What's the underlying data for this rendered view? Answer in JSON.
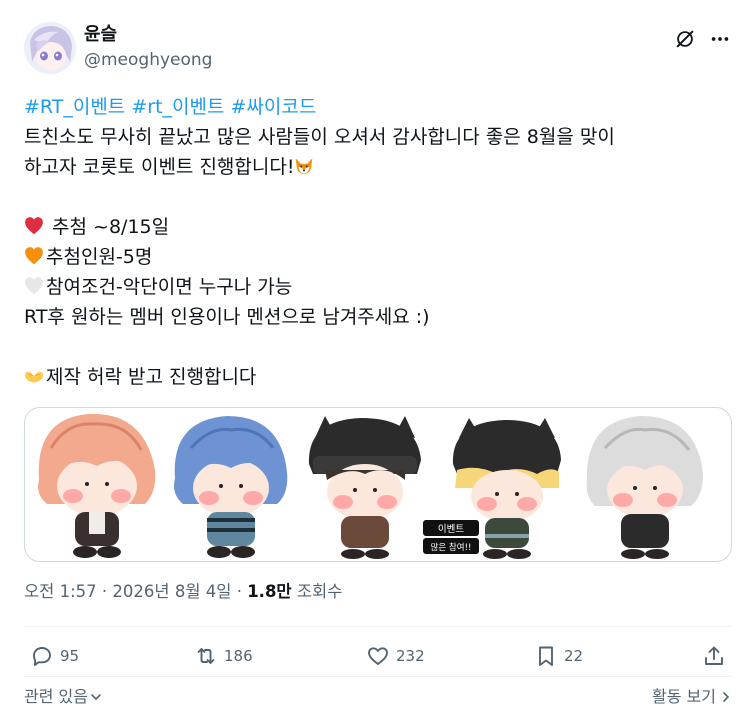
{
  "author": {
    "display_name": "윤슬",
    "handle": "@meoghyeong"
  },
  "tweet": {
    "hashtags": [
      "#RT_이벤트",
      "#rt_이벤트",
      "#싸이코드"
    ],
    "line2": "트친소도 무사히 끝났고 많은 사람들이 오셔서 감사합니다  좋은 8월을 맞이",
    "line3": "하고자 코롯토 이벤트 진행합니다!",
    "line5": " 추첨 ~8/15일",
    "line6": "추첨인원-5명",
    "line7": "참여조건-악단이면 누구나 가능",
    "line8": "RT후 원하는 멤버 인용이나 멘션으로 남겨주세요 :)",
    "line10": "제작 허락 받고 진행합니다"
  },
  "media": {
    "badge_line1": "이벤트",
    "badge_line2": "많은 참여!!"
  },
  "meta": {
    "time": "오전 1:57",
    "sep1": " · ",
    "date": "2026년 8월 4일",
    "sep2": " · ",
    "views_count": "1.8만",
    "views_label": " 조회수"
  },
  "actions": {
    "replies": "95",
    "retweets": "186",
    "likes": "232",
    "bookmarks": "22"
  },
  "footer": {
    "related": "관련 있음",
    "activity": "활동 보기"
  },
  "colors": {
    "accent": "#1d9bf0",
    "muted": "#536471",
    "heart_red": "#dd2e44",
    "heart_orange": "#f4900c",
    "heart_white": "#e6e7e8"
  },
  "icons": [
    "grok-icon",
    "more-icon",
    "fox-emoji",
    "red-heart-emoji",
    "orange-heart-emoji",
    "white-heart-emoji",
    "heart-hands-emoji",
    "reply-icon",
    "retweet-icon",
    "like-icon",
    "bookmark-icon",
    "share-icon",
    "chevron-down-icon",
    "chevron-right-icon"
  ]
}
